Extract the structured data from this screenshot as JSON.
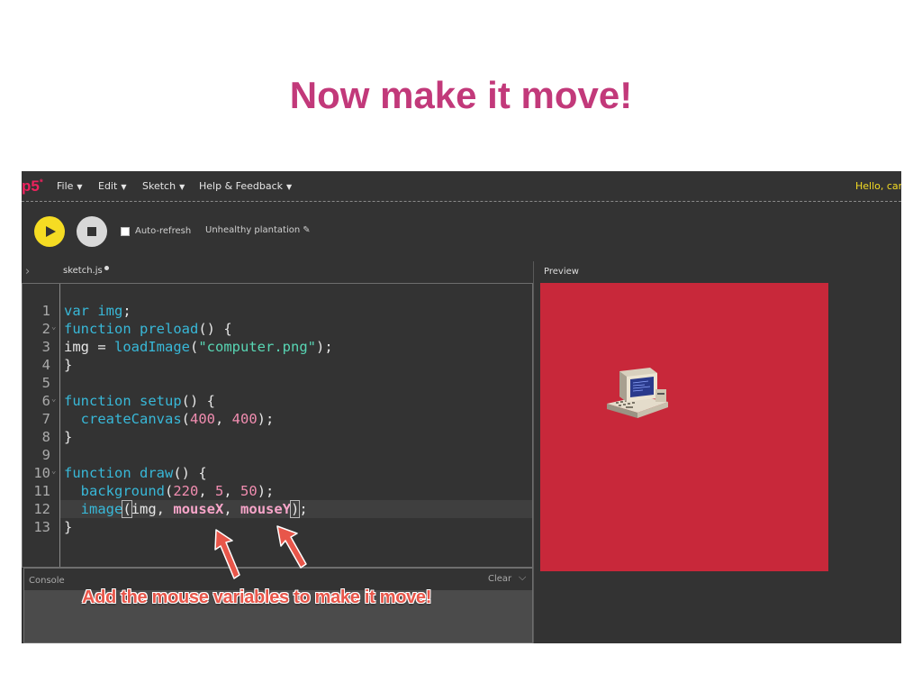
{
  "slide": {
    "title": "Now make it move!"
  },
  "menubar": {
    "logo": "p5",
    "logo_mark": "*",
    "items": [
      {
        "label": "File",
        "caret": "▼"
      },
      {
        "label": "Edit",
        "caret": "▼"
      },
      {
        "label": "Sketch",
        "caret": "▼"
      },
      {
        "label": "Help & Feedback",
        "caret": "▼"
      }
    ],
    "greeting": "Hello, carri"
  },
  "toolbar": {
    "auto_refresh_label": "Auto-refresh",
    "auto_refresh_checked": false,
    "project_name": "Unhealthy plantation",
    "edit_icon": "pencil-icon"
  },
  "editor": {
    "tab_name": "sketch.js",
    "tab_unsaved": true,
    "lines": [
      {
        "n": "1",
        "text": "var img;"
      },
      {
        "n": "2",
        "text": "function preload() {",
        "fold": true
      },
      {
        "n": "3",
        "text": "img = loadImage(\"computer.png\");"
      },
      {
        "n": "4",
        "text": "}"
      },
      {
        "n": "5",
        "text": ""
      },
      {
        "n": "6",
        "text": "function setup() {",
        "fold": true
      },
      {
        "n": "7",
        "text": "  createCanvas(400, 400);"
      },
      {
        "n": "8",
        "text": "}"
      },
      {
        "n": "9",
        "text": ""
      },
      {
        "n": "10",
        "text": "function draw() {",
        "fold": true
      },
      {
        "n": "11",
        "text": "  background(220, 5, 50);"
      },
      {
        "n": "12",
        "text": "  image(img, mouseX, mouseY);",
        "active": true
      },
      {
        "n": "13",
        "text": "}"
      }
    ],
    "fold_glyph": "⌄"
  },
  "console": {
    "label": "Console",
    "clear_label": "Clear",
    "collapse_icon": "chevron-down-icon"
  },
  "preview": {
    "label": "Preview",
    "background_color": "#c8283a",
    "sprite": "computer-image"
  },
  "annotation": {
    "text": "Add the mouse variables to make it move!",
    "color": "#e8564a"
  },
  "colors": {
    "title": "#c2397a",
    "accent_yellow": "#f5dc23",
    "logo": "#ed225d",
    "editor_bg": "#333333"
  }
}
